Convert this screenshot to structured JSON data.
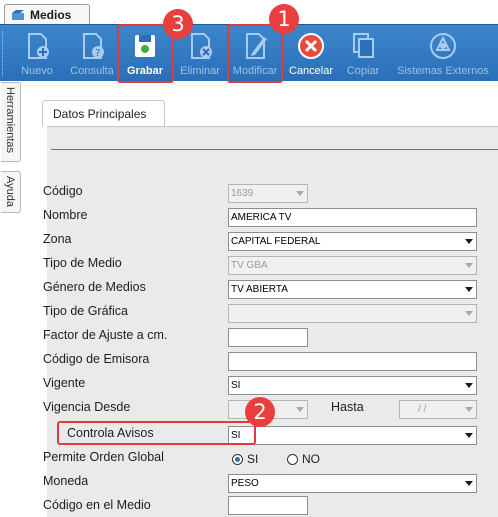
{
  "tabs": {
    "active": "Medios"
  },
  "toolbar": {
    "buttons": [
      {
        "id": "nuevo",
        "label": "Nuevo",
        "icon": "new-document-icon",
        "enabled": false
      },
      {
        "id": "consulta",
        "label": "Consulta",
        "icon": "query-document-icon",
        "enabled": false
      },
      {
        "id": "grabar",
        "label": "Grabar",
        "icon": "save-disk-icon",
        "enabled": true
      },
      {
        "id": "eliminar",
        "label": "Eliminar",
        "icon": "delete-icon",
        "enabled": false
      },
      {
        "id": "modificar",
        "label": "Modificar",
        "icon": "edit-pencil-icon",
        "enabled": false
      },
      {
        "id": "cancelar",
        "label": "Cancelar",
        "icon": "cancel-icon",
        "enabled": true
      },
      {
        "id": "copiar",
        "label": "Copiar",
        "icon": "copy-icon",
        "enabled": false
      },
      {
        "id": "sistemas_externos",
        "label": "Sistemas Externos",
        "icon": "external-systems-icon",
        "enabled": false
      }
    ]
  },
  "sidebar": {
    "tabs": [
      "Herramientas",
      "Ayuda"
    ]
  },
  "form": {
    "section_title": "Datos Principales",
    "fields": {
      "codigo": {
        "label": "Código",
        "value": "1639"
      },
      "nombre": {
        "label": "Nombre",
        "value": "AMERICA TV"
      },
      "zona": {
        "label": "Zona",
        "value": "CAPITAL FEDERAL"
      },
      "tipo_medio": {
        "label": "Tipo de Medio",
        "value": "TV GBA"
      },
      "genero_medios": {
        "label": "Género de Medios",
        "value": "TV ABIERTA"
      },
      "tipo_grafica": {
        "label": "Tipo de Gráfica",
        "value": ""
      },
      "factor_ajuste": {
        "label": "Factor de Ajuste a cm.",
        "value": ""
      },
      "codigo_emisora": {
        "label": "Código de Emisora",
        "value": ""
      },
      "vigente": {
        "label": "Vigente",
        "value": "SI"
      },
      "vigencia_desde": {
        "label": "Vigencia Desde",
        "value": ""
      },
      "hasta": {
        "label": "Hasta",
        "value": "/ /"
      },
      "controla_avisos": {
        "label": "Controla Avisos",
        "value": "SI"
      },
      "permite_orden_global": {
        "label": "Permite Orden Global",
        "options": [
          "SI",
          "NO"
        ],
        "selected": "SI"
      },
      "moneda": {
        "label": "Moneda",
        "value": "PESO"
      },
      "codigo_medio": {
        "label": "Código en el Medio",
        "value": ""
      }
    }
  },
  "callouts": [
    "1",
    "2",
    "3"
  ],
  "colors": {
    "toolbar": "#2a6fb7",
    "callout": "#e23b3b",
    "section_rule": "#3f7ec3"
  }
}
